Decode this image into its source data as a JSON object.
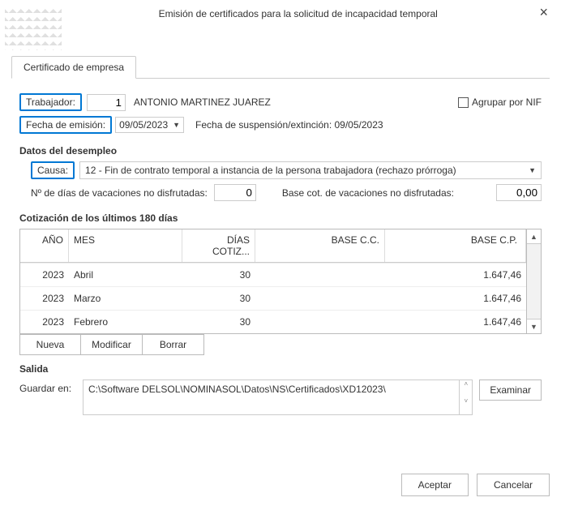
{
  "title": "Emisión de certificados para la solicitud de incapacidad temporal",
  "tab": "Certificado de empresa",
  "labels": {
    "trabajador": "Trabajador:",
    "fecha_emision": "Fecha de emisión:",
    "suspension": "Fecha de suspensión/extinción: 09/05/2023",
    "agrupar_nif": "Agrupar por NIF",
    "datos_desempleo": "Datos del desempleo",
    "causa": "Causa:",
    "dias_vac": "Nº de días de vacaciones no disfrutadas:",
    "base_vac": "Base cot. de vacaciones no disfrutadas:",
    "cotizacion": "Cotización de los últimos 180 días",
    "salida": "Salida",
    "guardar": "Guardar en:"
  },
  "trabajador_num": "1",
  "trabajador_nombre": "ANTONIO MARTINEZ JUAREZ",
  "fecha_emision": "09/05/2023",
  "causa_sel": "12 - Fin de contrato temporal a instancia de la persona trabajadora (rechazo prórroga)",
  "dias_vac_val": "0",
  "base_vac_val": "0,00",
  "thead": {
    "ano": "AÑO",
    "mes": "MES",
    "dias": "DÍAS COTIZ...",
    "cc": "BASE C.C.",
    "cp": "BASE C.P."
  },
  "rows": [
    {
      "ano": "2023",
      "mes": "Abril",
      "dias": "30",
      "cc": "",
      "cp": "1.647,46"
    },
    {
      "ano": "2023",
      "mes": "Marzo",
      "dias": "30",
      "cc": "",
      "cp": "1.647,46"
    },
    {
      "ano": "2023",
      "mes": "Febrero",
      "dias": "30",
      "cc": "",
      "cp": "1.647,46"
    }
  ],
  "buttons": {
    "nueva": "Nueva",
    "modificar": "Modificar",
    "borrar": "Borrar",
    "examinar": "Examinar",
    "aceptar": "Aceptar",
    "cancelar": "Cancelar"
  },
  "path": "C:\\Software DELSOL\\NOMINASOL\\Datos\\NS\\Certificados\\XD12023\\"
}
